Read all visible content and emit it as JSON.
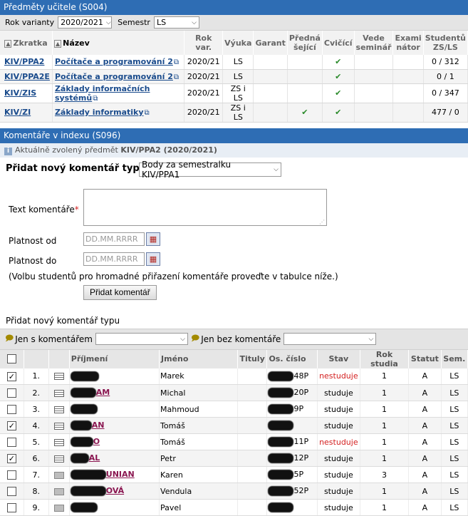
{
  "subjects_panel": {
    "title": "Předměty učitele (S004)",
    "filter": {
      "variant_label": "Rok varianty",
      "variant_value": "2020/2021",
      "semester_label": "Semestr",
      "semester_value": "LS"
    },
    "columns": [
      "Zkratka",
      "Název",
      "Rok var.",
      "Výuka",
      "Garant",
      "Přednášející",
      "Cvičící",
      "Vede seminář",
      "Examinátor",
      "Studentů ZS/LS"
    ],
    "column_headers": {
      "zkratka": "Zkratka",
      "nazev": "Název",
      "rok": "Rok var.",
      "vyuka": "Výuka",
      "garant": "Garant",
      "prednasejici_1": "Předná",
      "prednasejici_2": "šející",
      "cvicici": "Cvičící",
      "vede_1": "Vede",
      "vede_2": "seminář",
      "exam_1": "Exami",
      "exam_2": "nátor",
      "stud_1": "Studentů",
      "stud_2": "ZS/LS"
    },
    "rows": [
      {
        "code": "KIV/PPA2",
        "name": "Počítače a programování 2",
        "year": "2020/21",
        "teaching": "LS",
        "garant": "",
        "lecturer": "",
        "tutor": "✔",
        "seminar": "",
        "examiner": "",
        "students": "0 / 312"
      },
      {
        "code": "KIV/PPA2E",
        "name": "Počítače a programování 2",
        "year": "2020/21",
        "teaching": "LS",
        "garant": "",
        "lecturer": "",
        "tutor": "✔",
        "seminar": "",
        "examiner": "",
        "students": "0 / 1"
      },
      {
        "code": "KIV/ZIS",
        "name": "Základy informačních systémů",
        "year": "2020/21",
        "teaching": "ZS i LS",
        "garant": "",
        "lecturer": "",
        "tutor": "✔",
        "seminar": "",
        "examiner": "",
        "students": "0 / 347"
      },
      {
        "code": "KIV/ZI",
        "name": "Základy informatiky",
        "year": "2020/21",
        "teaching": "ZS i LS",
        "garant": "",
        "lecturer": "✔",
        "tutor": "✔",
        "seminar": "",
        "examiner": "",
        "students": "477 / 0"
      }
    ]
  },
  "comments_panel": {
    "title": "Komentáře v indexu (S096)",
    "info_prefix": "Aktuálně zvolený předmět",
    "info_subject": "KIV/PPA2 (2020/2021)",
    "add_type_label": "Přidat nový komentář typu",
    "add_type_value": "Body za semestralku KIV/PPA1",
    "text_label": "Text komentáře",
    "required_mark": "*",
    "valid_from_label": "Platnost od",
    "valid_to_label": "Platnost do",
    "date_placeholder": "DD.MM.RRRR",
    "note": "(Volbu studentů pro hromadné přiřazení komentáře proveďte v tabulce níže.)",
    "add_button": "Přidat komentář",
    "add_type_label_2": "Přidat nový komentář typu"
  },
  "student_filter": {
    "with_comment_label": "Jen s komentářem",
    "without_comment_label": "Jen bez komentáře"
  },
  "students": {
    "headers": {
      "surname": "Příjmení",
      "name": "Jméno",
      "titles": "Tituly",
      "os_number": "Os. číslo",
      "status": "Stav",
      "year": "Rok studia",
      "statut": "Statut",
      "sem": "Sem."
    },
    "rows": [
      {
        "index": "1.",
        "checked": true,
        "icon": "lined",
        "surname_tail": "",
        "name": "Marek",
        "os_tail": "48P",
        "status": "nestuduje",
        "status_color": "#d42020",
        "year": "1",
        "statut": "A",
        "sem": "LS"
      },
      {
        "index": "2.",
        "checked": false,
        "icon": "lined",
        "surname_tail": "AM",
        "name": "Michal",
        "os_tail": "20P",
        "status": "studuje",
        "status_color": "#000000",
        "year": "1",
        "statut": "A",
        "sem": "LS"
      },
      {
        "index": "3.",
        "checked": false,
        "icon": "lined",
        "surname_tail": "",
        "name": "Mahmoud",
        "os_tail": "9P",
        "status": "studuje",
        "status_color": "#000000",
        "year": "1",
        "statut": "A",
        "sem": "LS"
      },
      {
        "index": "4.",
        "checked": true,
        "icon": "lined",
        "surname_tail": "AN",
        "name": "Tomáš",
        "os_tail": "",
        "status": "studuje",
        "status_color": "#000000",
        "year": "1",
        "statut": "A",
        "sem": "LS"
      },
      {
        "index": "5.",
        "checked": false,
        "icon": "lined",
        "surname_tail": "O",
        "name": "Tomáš",
        "os_tail": "11P",
        "status": "nestuduje",
        "status_color": "#d42020",
        "year": "1",
        "statut": "A",
        "sem": "LS"
      },
      {
        "index": "6.",
        "checked": true,
        "icon": "lined",
        "surname_tail": "AL",
        "name": "Petr",
        "os_tail": "12P",
        "status": "studuje",
        "status_color": "#000000",
        "year": "1",
        "statut": "A",
        "sem": "LS"
      },
      {
        "index": "7.",
        "checked": false,
        "icon": "gray",
        "surname_tail": "UNIAN",
        "name": "Karen",
        "os_tail": "5P",
        "status": "studuje",
        "status_color": "#000000",
        "year": "3",
        "statut": "A",
        "sem": "LS"
      },
      {
        "index": "8.",
        "checked": false,
        "icon": "gray",
        "surname_tail": "OVÁ",
        "name": "Vendula",
        "os_tail": "52P",
        "status": "studuje",
        "status_color": "#000000",
        "year": "1",
        "statut": "A",
        "sem": "LS"
      },
      {
        "index": "9.",
        "checked": false,
        "icon": "gray",
        "surname_tail": "",
        "name": "Pavel",
        "os_tail": "",
        "status": "studuje",
        "status_color": "#000000",
        "year": "1",
        "statut": "A",
        "sem": "LS"
      }
    ]
  },
  "colors": {
    "header_blue": "#2e6db4",
    "link_blue": "#1a4b8c",
    "check_green": "#2a8a2a",
    "status_red": "#d42020",
    "surname_link": "#8a1550"
  }
}
